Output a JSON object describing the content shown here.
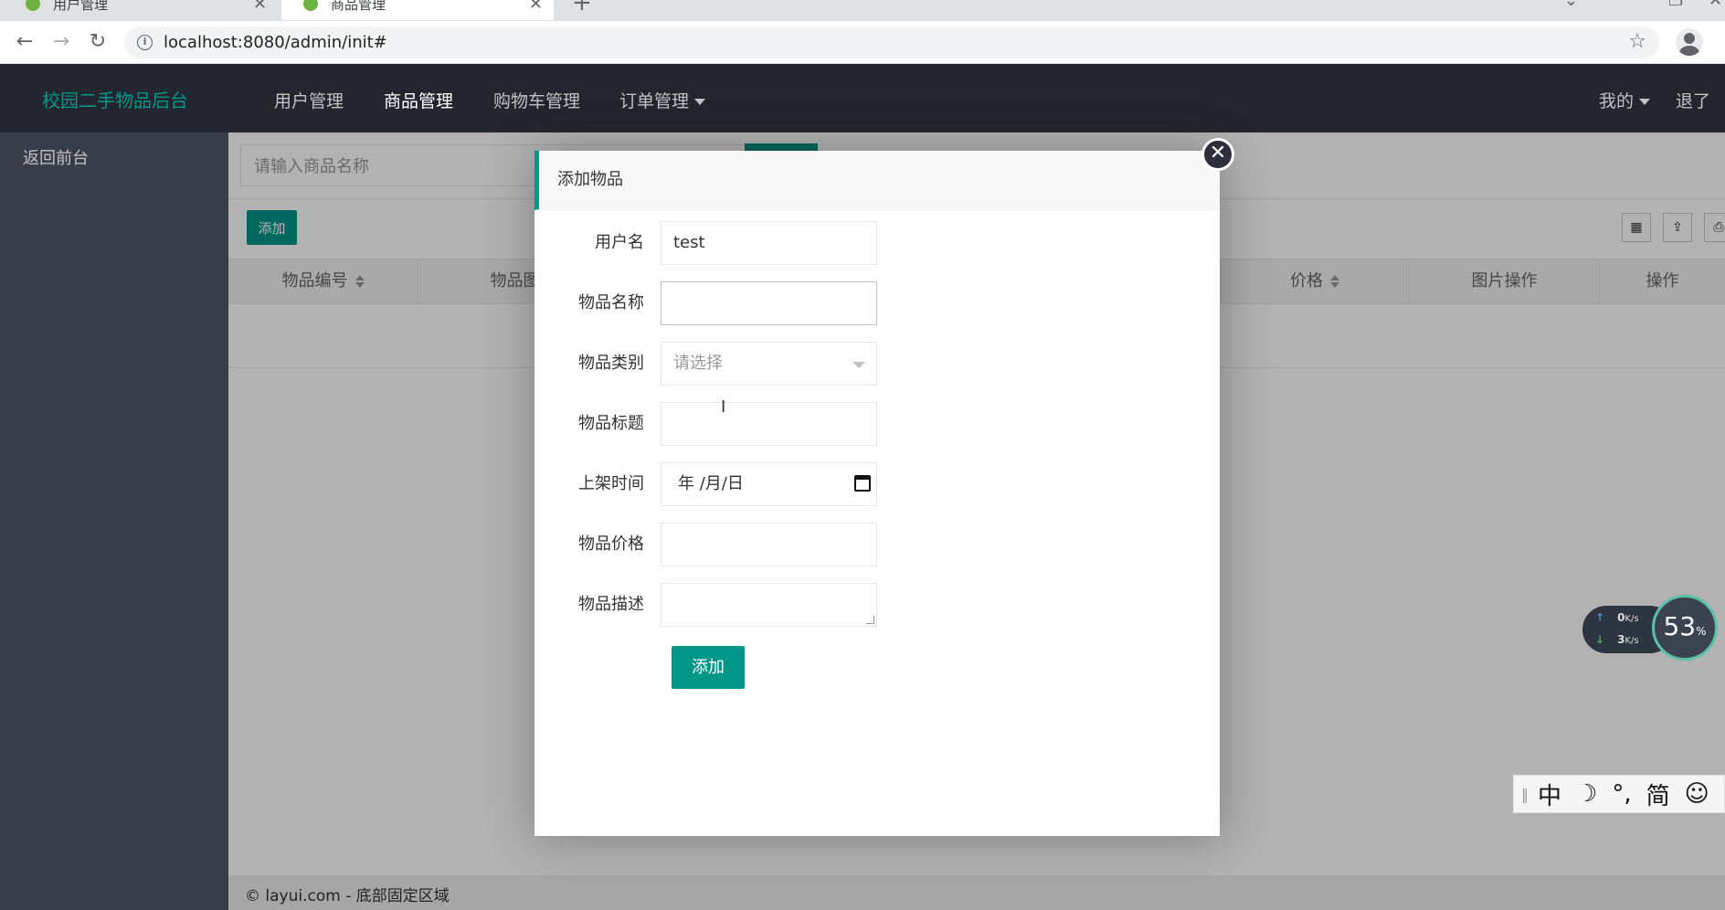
{
  "browser": {
    "tabs": [
      {
        "title": "用户管理",
        "active": false
      },
      {
        "title": "商品管理",
        "active": true
      }
    ],
    "url": "localhost:8080/admin/init#"
  },
  "header": {
    "logo": "校园二手物品后台",
    "nav": [
      {
        "label": "用户管理"
      },
      {
        "label": "商品管理",
        "active": true
      },
      {
        "label": "购物车管理"
      },
      {
        "label": "订单管理"
      }
    ],
    "right": {
      "me": "我的",
      "logout": "退了"
    }
  },
  "sidebar": {
    "items": [
      {
        "label": "返回前台"
      }
    ]
  },
  "toolbar": {
    "search_placeholder": "请输入商品名称",
    "add_label": "添加"
  },
  "table": {
    "columns": [
      "物品编号",
      "物品图片",
      "价格",
      "图片操作",
      "操作"
    ]
  },
  "footer": {
    "text": "© layui.com - 底部固定区域"
  },
  "dialog": {
    "title": "添加物品",
    "fields": [
      {
        "label": "用户名",
        "value": "test"
      },
      {
        "label": "物品名称",
        "value": ""
      },
      {
        "label": "物品类别",
        "value": "",
        "placeholder": "请选择"
      },
      {
        "label": "物品标题",
        "value": ""
      },
      {
        "label": "上架时间",
        "value": "年 /月/日"
      },
      {
        "label": "物品价格",
        "value": ""
      },
      {
        "label": "物品描述",
        "value": ""
      }
    ],
    "submit_label": "添加",
    "close_icon": "✕"
  },
  "netmon": {
    "up": "0",
    "down": "3",
    "unit": "K/s",
    "percent": "53",
    "percent_unit": "%"
  },
  "ime": {
    "items": [
      "中",
      "☽",
      "°,",
      "简",
      "☺"
    ]
  },
  "colors": {
    "accent": "#009688",
    "header_bg": "#23262e",
    "sidebar_bg": "#393d49"
  }
}
